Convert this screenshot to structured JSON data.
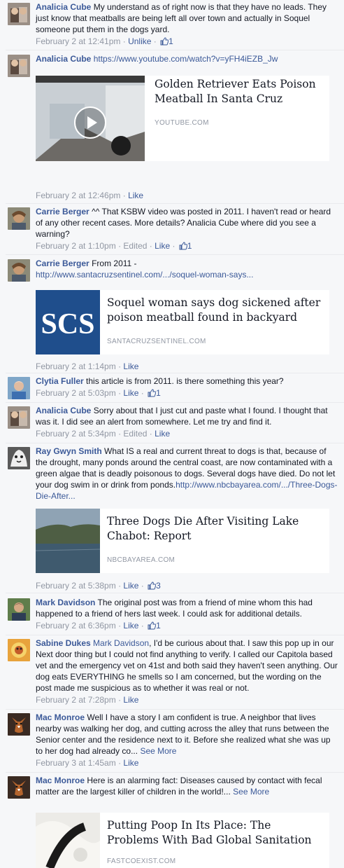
{
  "comments": [
    {
      "author": "",
      "text": "My understand as of right now is that they have no leads. They just know that meatballs are being left all over town and actually in Soquel someone put them in the dogs yard.",
      "lead": "Analicia Cube",
      "time": "February 2 at 12:41pm",
      "action": "Unlike",
      "likes": "1"
    },
    {
      "author": "Analicia Cube",
      "link": "https://www.youtube.com/watch?v=yFH4iEZB_Jw",
      "time": "February 2 at 12:46pm",
      "action": "Like",
      "share": {
        "title": "Golden Retriever Eats Poison Meatball In Santa Cruz",
        "domain": "YOUTUBE.COM"
      }
    },
    {
      "author": "Carrie Berger",
      "text": "^^ That KSBW video was posted in 2011. I haven't read or heard of any other recent cases. More details? Analicia Cube where did you see a warning?",
      "time": "February 2 at 1:10pm",
      "edited": "Edited",
      "action": "Like",
      "likes": "1"
    },
    {
      "author": "Carrie Berger",
      "text": "From 2011 -",
      "link": "http://www.santacruzsentinel.com/.../soquel-woman-says...",
      "time": "February 2 at 1:14pm",
      "action": "Like",
      "share": {
        "title": "Soquel woman says dog sickened after poison meatball found in backyard",
        "domain": "SANTACRUZSENTINEL.COM",
        "logo": "SCS"
      }
    },
    {
      "author": "Clytia Fuller",
      "text": "this article is from 2011. is there something this year?",
      "time": "February 2 at 5:03pm",
      "action": "Like",
      "likes": "1"
    },
    {
      "author": "Analicia Cube",
      "text": "Sorry about that I just cut and paste what I found. I thought that was it. I did see an alert from somewhere. Let me try and find it.",
      "time": "February 2 at 5:34pm",
      "edited": "Edited",
      "action": "Like"
    },
    {
      "author": "Ray Gwyn Smith",
      "text": "What IS a real and current threat to dogs is that, because of the drought, many ponds around the central coast, are now contaminated with a green algae that is deadly poisonous to dogs. Several dogs have died. Do not let your dog swim in or drink from ponds.",
      "link": "http://www.nbcbayarea.com/.../Three-Dogs-Die-After...",
      "time": "February 2 at 5:38pm",
      "action": "Like",
      "likes": "3",
      "share": {
        "title": "Three Dogs Die After Visiting Lake Chabot: Report",
        "domain": "NBCBAYAREA.COM"
      }
    },
    {
      "author": "Mark Davidson",
      "text": "The original post was from a friend of mine whom this had happened to a friend of hers last week. I could ask for additional details.",
      "time": "February 2 at 6:36pm",
      "action": "Like",
      "likes": "1"
    },
    {
      "author": "Sabine Dukes",
      "mention": "Mark Davidson",
      "text": ", I'd be curious about that. I saw this pop up in our Next door thing but I could not find anything to verify. I called our Capitola based vet and the emergency vet on 41st and both said they haven't seen anything. Our dog eats EVERYTHING he smells so I am concerned, but the wording on the post made me suspicious as to whether it was real or not.",
      "time": "February 2 at 7:28pm",
      "action": "Like"
    },
    {
      "author": "Mac Monroe",
      "text": "Well I have a story I am confident is true. A neighbor that lives nearby was walking her dog, and cutting across the alley that runs between the Senior center and the residence next to it. Before she realized what she was up to her dog had already co...",
      "see_more": "See More",
      "time": "February 3 at 1:45am",
      "action": "Like"
    },
    {
      "author": "Mac Monroe",
      "text": "Here is an alarming fact: Diseases caused by contact with fecal matter are the largest killer of children in the world!...",
      "see_more": "See More",
      "share": {
        "title": "Putting Poop In Its Place: The Problems With Bad Global Sanitation",
        "domain": "FASTCOEXIST.COM"
      }
    }
  ],
  "colors": {
    "link": "#3b5998",
    "meta": "#9197a3",
    "text": "#141823",
    "background": "#f6f7f9"
  }
}
